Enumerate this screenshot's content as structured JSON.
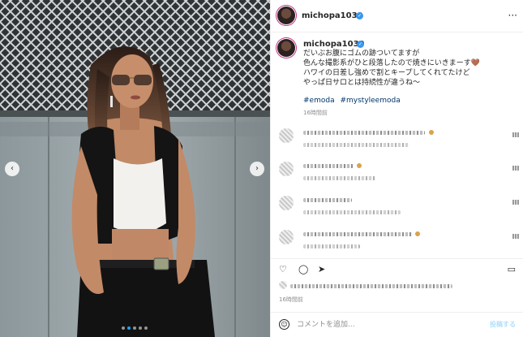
{
  "post": {
    "username": "michopa1030",
    "caption_lines": [
      "だいぶお腹にゴムの跡ついてますが",
      "色んな撮影系がひと段落したので焼きにいきまーす🤎",
      "ハワイの日差し強めで割とキープしてくれてたけど",
      "やっぱ日サロとは持続性が違うね〜"
    ],
    "hashtags": [
      "#emoda",
      "#mystyleemoda"
    ],
    "caption_time": "16時間前",
    "post_time": "16時間前"
  },
  "comments": [
    {
      "id": 1
    },
    {
      "id": 2
    },
    {
      "id": 3
    },
    {
      "id": 4
    }
  ],
  "composer": {
    "placeholder": "コメントを追加...",
    "post_label": "投稿する"
  },
  "icons": {
    "verified": "✓",
    "more": "···",
    "prev": "‹",
    "next": "›",
    "heart": "♡",
    "comment": "◯",
    "share": "➤",
    "save": "▭",
    "emoji": "☺"
  },
  "carousel": {
    "slides": 5,
    "active_index": 1
  },
  "colors": {
    "verified": "#3897f0",
    "hashtag": "#00376b",
    "post_button": "#b2dffc"
  }
}
